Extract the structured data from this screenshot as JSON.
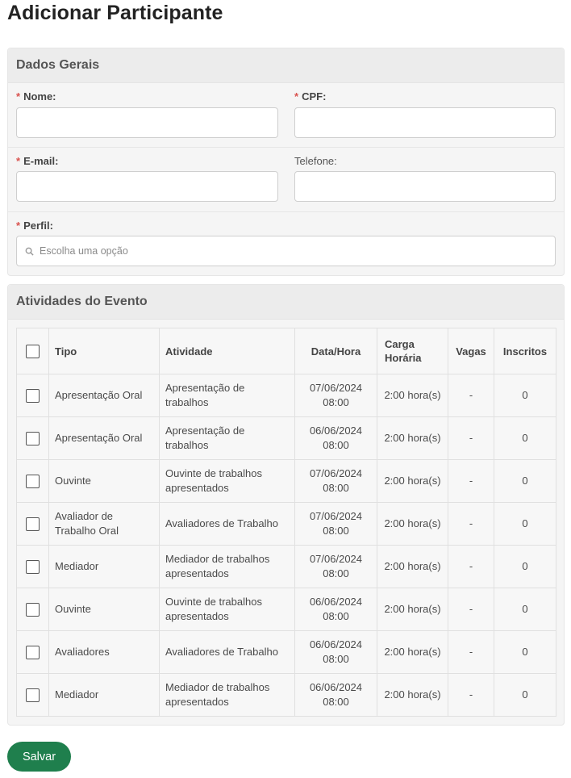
{
  "page": {
    "title": "Adicionar Participante"
  },
  "dados_gerais": {
    "title": "Dados Gerais",
    "required_mark": "*",
    "nome_label": "Nome:",
    "nome_value": "",
    "cpf_label": "CPF:",
    "cpf_value": "",
    "email_label": "E-mail:",
    "email_value": "",
    "telefone_label": "Telefone:",
    "telefone_value": "",
    "perfil_label": "Perfil:",
    "perfil_placeholder": "Escolha uma opção"
  },
  "atividades": {
    "title": "Atividades do Evento",
    "headers": {
      "tipo": "Tipo",
      "atividade": "Atividade",
      "data_hora": "Data/Hora",
      "carga_horaria": "Carga Horária",
      "vagas": "Vagas",
      "inscritos": "Inscritos"
    },
    "rows": [
      {
        "checked": false,
        "tipo": "Apresentação Oral",
        "atividade": "Apresentação de trabalhos",
        "data": "07/06/2024",
        "hora": "08:00",
        "carga": "2:00 hora(s)",
        "vagas": "-",
        "inscritos": "0"
      },
      {
        "checked": false,
        "tipo": "Apresentação Oral",
        "atividade": "Apresentação de trabalhos",
        "data": "06/06/2024",
        "hora": "08:00",
        "carga": "2:00 hora(s)",
        "vagas": "-",
        "inscritos": "0"
      },
      {
        "checked": false,
        "tipo": "Ouvinte",
        "atividade": "Ouvinte de trabalhos apresentados",
        "data": "07/06/2024",
        "hora": "08:00",
        "carga": "2:00 hora(s)",
        "vagas": "-",
        "inscritos": "0"
      },
      {
        "checked": false,
        "tipo": "Avaliador de Trabalho Oral",
        "atividade": "Avaliadores de Trabalho",
        "data": "07/06/2024",
        "hora": "08:00",
        "carga": "2:00 hora(s)",
        "vagas": "-",
        "inscritos": "0"
      },
      {
        "checked": false,
        "tipo": "Mediador",
        "atividade": "Mediador de trabalhos apresentados",
        "data": "07/06/2024",
        "hora": "08:00",
        "carga": "2:00 hora(s)",
        "vagas": "-",
        "inscritos": "0"
      },
      {
        "checked": false,
        "tipo": "Ouvinte",
        "atividade": "Ouvinte de trabalhos apresentados",
        "data": "06/06/2024",
        "hora": "08:00",
        "carga": "2:00 hora(s)",
        "vagas": "-",
        "inscritos": "0"
      },
      {
        "checked": false,
        "tipo": "Avaliadores",
        "atividade": "Avaliadores de Trabalho",
        "data": "06/06/2024",
        "hora": "08:00",
        "carga": "2:00 hora(s)",
        "vagas": "-",
        "inscritos": "0"
      },
      {
        "checked": false,
        "tipo": "Mediador",
        "atividade": "Mediador de trabalhos apresentados",
        "data": "06/06/2024",
        "hora": "08:00",
        "carga": "2:00 hora(s)",
        "vagas": "-",
        "inscritos": "0"
      }
    ]
  },
  "actions": {
    "save_label": "Salvar"
  },
  "colors": {
    "accent": "#1f7f4d",
    "required": "#d9534f"
  },
  "icons": {
    "perfil_search": "search-icon"
  }
}
